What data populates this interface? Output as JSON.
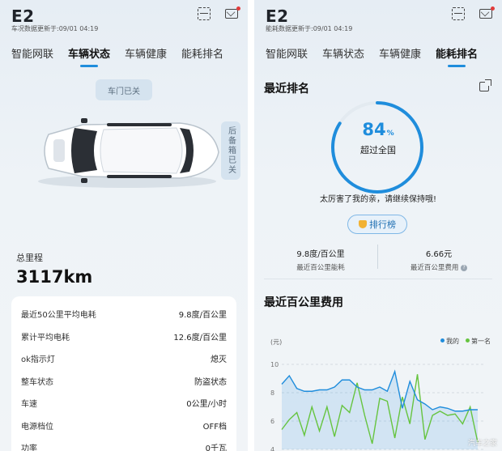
{
  "left": {
    "title": "E2",
    "subtitle": "车况数据更新于:09/01 04:19",
    "tabs": [
      {
        "label": "智能网联"
      },
      {
        "label": "车辆状态"
      },
      {
        "label": "车辆健康"
      },
      {
        "label": "能耗排名"
      }
    ],
    "active_tab": "车辆状态",
    "door_status": "车门已关",
    "trunk_status": "后备箱已关",
    "odometer_label": "总里程",
    "odometer_value": "3117km",
    "stats": [
      {
        "label": "最近50公里平均电耗",
        "value": "9.8度/百公里"
      },
      {
        "label": "累计平均电耗",
        "value": "12.6度/百公里"
      },
      {
        "label": "ok指示灯",
        "value": "熄灭"
      },
      {
        "label": "整车状态",
        "value": "防盗状态"
      },
      {
        "label": "车速",
        "value": "0公里/小时"
      },
      {
        "label": "电源档位",
        "value": "OFF档"
      },
      {
        "label": "功率",
        "value": "0千瓦"
      }
    ]
  },
  "right": {
    "title": "E2",
    "subtitle": "能耗数据更新于:09/01 04:19",
    "tabs": [
      {
        "label": "智能网联"
      },
      {
        "label": "车辆状态"
      },
      {
        "label": "车辆健康"
      },
      {
        "label": "能耗排名"
      }
    ],
    "active_tab": "能耗排名",
    "ranking_title": "最近排名",
    "percent": 84,
    "percent_value": "84",
    "percent_unit": "%",
    "beyond_label": "超过全国",
    "praise": "太厉害了我的亲，请继续保持哦!",
    "rank_button": "排行榜",
    "metrics": [
      {
        "value": "9.8度/百公里",
        "label": "最近百公里能耗"
      },
      {
        "value": "6.66元",
        "label": "最近百公里费用"
      }
    ],
    "cost_title": "最近百公里费用"
  },
  "chart_data": {
    "type": "line",
    "title": "最近百公里费用",
    "ylabel": "(元)",
    "ylim": [
      4,
      10
    ],
    "yticks": [
      4,
      6,
      8,
      10
    ],
    "grid": true,
    "legend_position": "top-right",
    "series": [
      {
        "name": "我的",
        "color": "#1f8ddc",
        "values": [
          8.6,
          9.2,
          8.3,
          8.1,
          8.1,
          8.2,
          8.2,
          8.4,
          8.9,
          8.9,
          8.4,
          8.2,
          8.2,
          8.4,
          8.1,
          9.5,
          6.9,
          8.8,
          7.5,
          7.2,
          6.8,
          7.0,
          6.9,
          6.7,
          6.7,
          6.8,
          6.8
        ]
      },
      {
        "name": "第一名",
        "color": "#66c43f",
        "values": [
          5.4,
          6.1,
          6.6,
          5.0,
          7.0,
          5.3,
          7.0,
          4.9,
          7.1,
          6.6,
          8.7,
          6.4,
          4.4,
          7.6,
          7.4,
          4.8,
          7.7,
          5.8,
          9.3,
          4.7,
          6.4,
          6.7,
          6.4,
          6.5,
          5.8,
          7.0,
          4.5
        ]
      }
    ]
  },
  "colors": {
    "accent": "#1f8ddc",
    "first_place": "#66c43f",
    "pill_bg": "#d5e3ef"
  },
  "icons": [
    "scan-icon",
    "mail-icon",
    "share-icon",
    "trophy-icon",
    "info-icon"
  ],
  "watermark": "汽车之家"
}
